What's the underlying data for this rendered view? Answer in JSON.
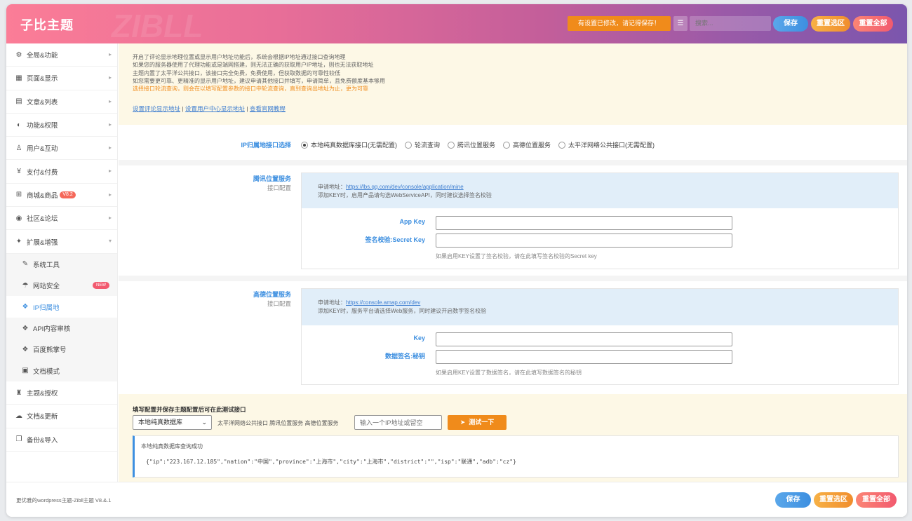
{
  "header": {
    "logo": "子比主题",
    "notice": "有设置已修改，请记得保存！",
    "search_placeholder": "搜索...",
    "save": "保存",
    "reset_section": "重置选区",
    "reset_all": "重置全部"
  },
  "sidebar": {
    "items": [
      {
        "label": "全局&功能",
        "icon": "gear-icon",
        "glyph": "⚙"
      },
      {
        "label": "页面&显示",
        "icon": "calendar-icon",
        "glyph": "▦"
      },
      {
        "label": "文章&列表",
        "icon": "map-icon",
        "glyph": "▤"
      },
      {
        "label": "功能&权限",
        "icon": "shield-icon",
        "glyph": "◐"
      },
      {
        "label": "用户&互动",
        "icon": "user-icon",
        "glyph": "♙"
      },
      {
        "label": "支付&付费",
        "icon": "yen-icon",
        "glyph": "¥"
      },
      {
        "label": "商城&商品",
        "icon": "cart-icon",
        "glyph": "⊞",
        "tag": "V8.2"
      },
      {
        "label": "社区&论坛",
        "icon": "compass-icon",
        "glyph": "◉"
      },
      {
        "label": "扩展&增强",
        "icon": "puzzle-icon",
        "glyph": "✦"
      }
    ],
    "subitems": [
      {
        "label": "系统工具",
        "icon": "wrench-icon",
        "glyph": "✎"
      },
      {
        "label": "网站安全",
        "icon": "umbrella-icon",
        "glyph": "☂",
        "badge": "NEW"
      },
      {
        "label": "IP归属地",
        "icon": "paw-icon",
        "glyph": "❖"
      },
      {
        "label": "API内容审核",
        "icon": "paw-icon",
        "glyph": "❖"
      },
      {
        "label": "百度熊掌号",
        "icon": "paw-icon",
        "glyph": "❖"
      },
      {
        "label": "文档模式",
        "icon": "file-icon",
        "glyph": "▣"
      }
    ],
    "bottom_items": [
      {
        "label": "主题&授权",
        "icon": "chart-icon",
        "glyph": "♜"
      },
      {
        "label": "文档&更新",
        "icon": "cloud-icon",
        "glyph": "☁"
      },
      {
        "label": "备份&导入",
        "icon": "copy-icon",
        "glyph": "❐"
      }
    ]
  },
  "notice_box": {
    "lines": [
      "开启了评论显示地理位置或显示用户地址功能后，系统会根据IP地址通过接口查询地理",
      "如果您的服务器使用了代理功能或是端网搭建，则无法正确的获取用户IP地址，则也无法获取地址",
      "主题内置了太平洋公共接口，该接口完全免费，免费使用，但获取数据的可靠性较低",
      "如您需要更可靠、更精准的显示用户地址，建议申请其他接口并填写，申请简单，且免费额度基本够用"
    ],
    "warn_line": "选择接口轮流查询，则会在以填写配置参数的接口中轮流查询，直到查询出地址为止，更为可靠",
    "link1": "设置评论显示地址",
    "link2": "设置用户中心显示地址",
    "link3": "查看官网教程",
    "divider": " | "
  },
  "ip_select": {
    "label": "IP归属地接口选择",
    "options": [
      "本地纯真数据库接口(无需配置)",
      "轮流查询",
      "腾讯位置服务",
      "高德位置服务",
      "太平洋网络公共接口(无需配置)"
    ],
    "selected_index": 0
  },
  "tencent": {
    "title": "腾讯位置服务",
    "subtitle": "接口配置",
    "apply_prefix": "申请地址：",
    "apply_url": "https://lbs.qq.com/dev/console/application/mine",
    "note": "添加KEY时，启用产品请勾选WebServiceAPI，同时建议选择签名校验",
    "key_label": "App Key",
    "secret_label": "签名校验:Secret Key",
    "help": "如果启用KEY设置了签名校验，请在此填写签名校验的Secret key"
  },
  "amap": {
    "title": "高德位置服务",
    "subtitle": "接口配置",
    "apply_prefix": "申请地址：",
    "apply_url": "https://console.amap.com/dev",
    "note": "添加KEY时，服务平台请选择Web服务，同时建议开启数字签名校验",
    "key_label": "Key",
    "secret_label": "数据签名:秘钥",
    "help": "如果启用KEY设置了数据签名，请在此填写数据签名的秘钥"
  },
  "test": {
    "title": "填写配置并保存主题配置后可在此测试接口",
    "select_value": "本地纯真数据库",
    "options_text": "太平洋网络公共接口 腾讯位置服务 高德位置服务",
    "ip_placeholder": "输入一个IP地址或留空",
    "button": "测试一下",
    "result_title": "本地纯真数据库查询成功",
    "result_json": "{\"ip\":\"223.167.12.185\",\"nation\":\"中国\",\"province\":\"上海市\",\"city\":\"上海市\",\"district\":\"\",\"isp\":\"联通\",\"adb\":\"cz\"}"
  },
  "footer": {
    "text": "更优雅的wordpress主题-Zibll主题 V8.&.1",
    "save": "保存",
    "reset_section": "重置选区",
    "reset_all": "重置全部"
  }
}
